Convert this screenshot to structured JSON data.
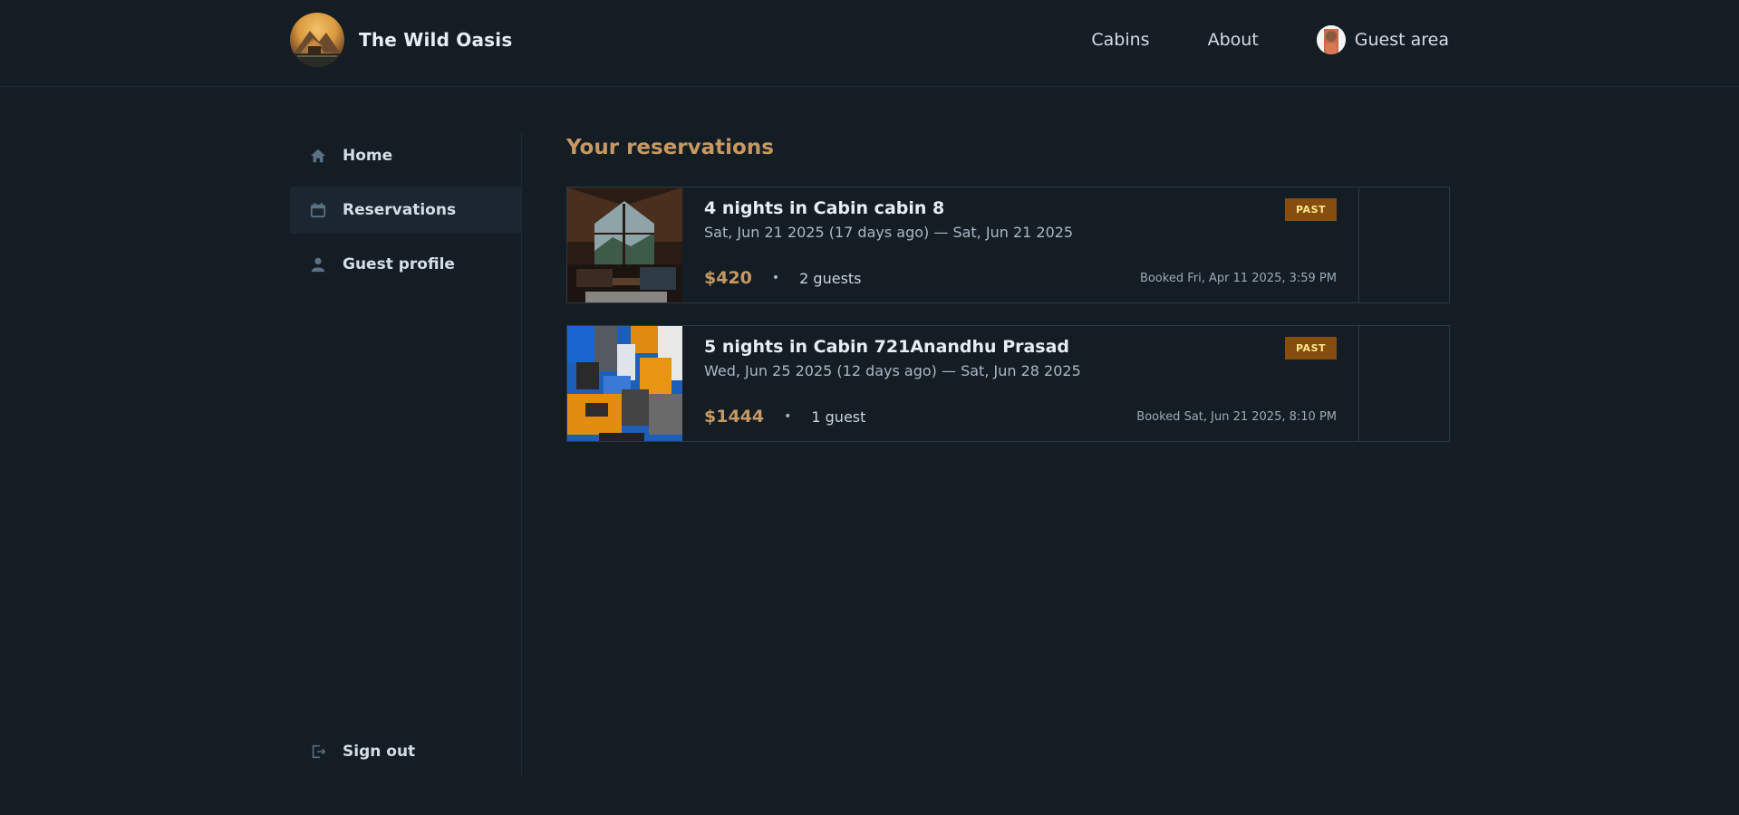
{
  "header": {
    "brand": "The Wild Oasis",
    "nav": [
      "Cabins",
      "About",
      "Guest area"
    ]
  },
  "sidebar": {
    "items": [
      {
        "label": "Home",
        "icon": "home-icon"
      },
      {
        "label": "Reservations",
        "icon": "calendar-icon"
      },
      {
        "label": "Guest profile",
        "icon": "user-icon"
      }
    ],
    "signout": {
      "label": "Sign out",
      "icon": "sign-out-icon"
    }
  },
  "main": {
    "title": "Your reservations",
    "reservations": [
      {
        "title": "4 nights in Cabin cabin 8",
        "dates": "Sat, Jun 21 2025 (17 days ago) — Sat, Jun 21 2025",
        "price": "$420",
        "guests": "2 guests",
        "booked": "Booked Fri, Apr 11 2025, 3:59 PM",
        "status": "PAST"
      },
      {
        "title": "5 nights in Cabin 721Anandhu Prasad",
        "dates": "Wed, Jun 25 2025 (12 days ago) — Sat, Jun 28 2025",
        "price": "$1444",
        "guests": "1 guest",
        "booked": "Booked Sat, Jun 21 2025, 8:10 PM",
        "status": "PAST"
      }
    ]
  },
  "colors": {
    "background": "#141c24",
    "accent": "#c69963",
    "badge_bg": "#854d0e",
    "badge_text": "#fde68a"
  }
}
